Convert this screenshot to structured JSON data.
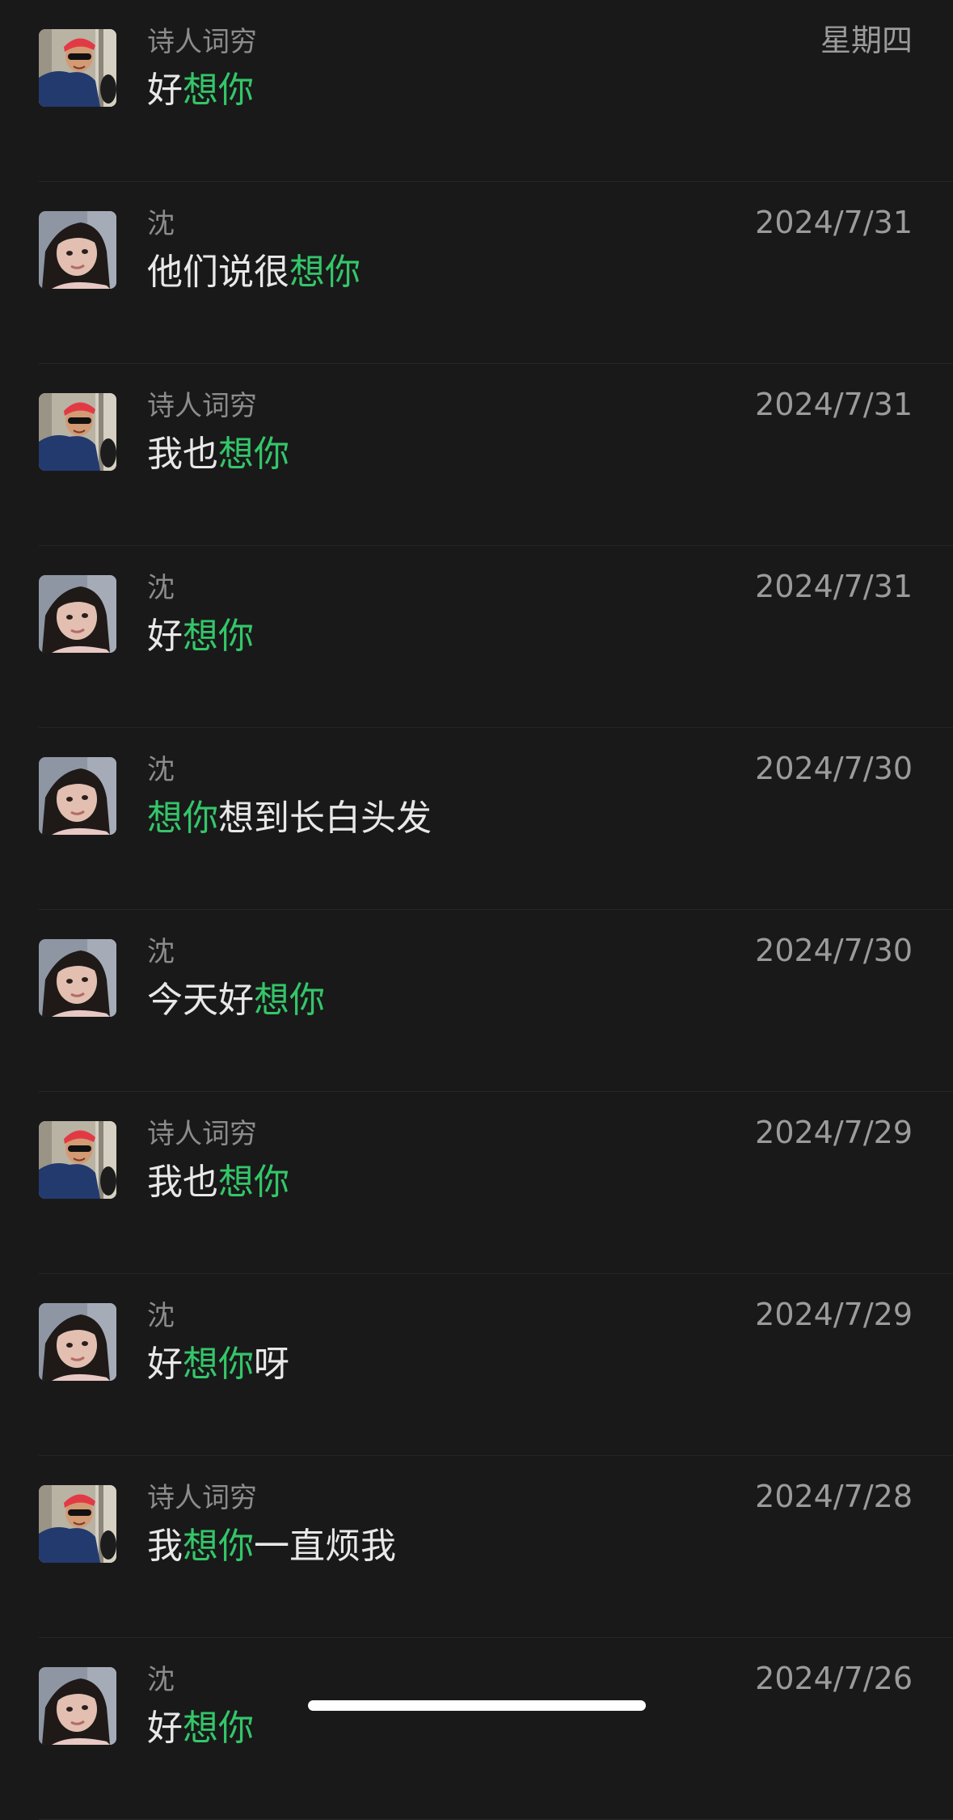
{
  "results": [
    {
      "sender": "诗人词穷",
      "avatar": "avatar-red-cap",
      "date": "星期四",
      "message": [
        {
          "text": "好",
          "hl": false
        },
        {
          "text": "想你",
          "hl": true
        }
      ]
    },
    {
      "sender": "沈",
      "avatar": "avatar-girl",
      "date": "2024/7/31",
      "message": [
        {
          "text": "他们说很",
          "hl": false
        },
        {
          "text": "想你",
          "hl": true
        }
      ]
    },
    {
      "sender": "诗人词穷",
      "avatar": "avatar-red-cap",
      "date": "2024/7/31",
      "message": [
        {
          "text": "我也",
          "hl": false
        },
        {
          "text": "想你",
          "hl": true
        }
      ]
    },
    {
      "sender": "沈",
      "avatar": "avatar-girl",
      "date": "2024/7/31",
      "message": [
        {
          "text": "好",
          "hl": false
        },
        {
          "text": "想你",
          "hl": true
        }
      ]
    },
    {
      "sender": "沈",
      "avatar": "avatar-girl",
      "date": "2024/7/30",
      "message": [
        {
          "text": "想你",
          "hl": true
        },
        {
          "text": "想到长白头发",
          "hl": false
        }
      ]
    },
    {
      "sender": "沈",
      "avatar": "avatar-girl",
      "date": "2024/7/30",
      "message": [
        {
          "text": "今天好",
          "hl": false
        },
        {
          "text": "想你",
          "hl": true
        }
      ]
    },
    {
      "sender": "诗人词穷",
      "avatar": "avatar-red-cap",
      "date": "2024/7/29",
      "message": [
        {
          "text": "我也",
          "hl": false
        },
        {
          "text": "想你",
          "hl": true
        }
      ]
    },
    {
      "sender": "沈",
      "avatar": "avatar-girl",
      "date": "2024/7/29",
      "message": [
        {
          "text": "好",
          "hl": false
        },
        {
          "text": "想你",
          "hl": true
        },
        {
          "text": "呀",
          "hl": false
        }
      ]
    },
    {
      "sender": "诗人词穷",
      "avatar": "avatar-red-cap",
      "date": "2024/7/28",
      "message": [
        {
          "text": "我",
          "hl": false
        },
        {
          "text": "想你",
          "hl": true
        },
        {
          "text": "一直烦我",
          "hl": false
        }
      ]
    },
    {
      "sender": "沈",
      "avatar": "avatar-girl",
      "date": "2024/7/26",
      "message": [
        {
          "text": "好",
          "hl": false
        },
        {
          "text": "想你",
          "hl": true
        }
      ]
    }
  ],
  "colors": {
    "background": "#191919",
    "highlight": "#34c66a",
    "message_text": "#e8e8e8",
    "sender_text": "#8c8c8c",
    "date_text": "#9b9b9b"
  }
}
